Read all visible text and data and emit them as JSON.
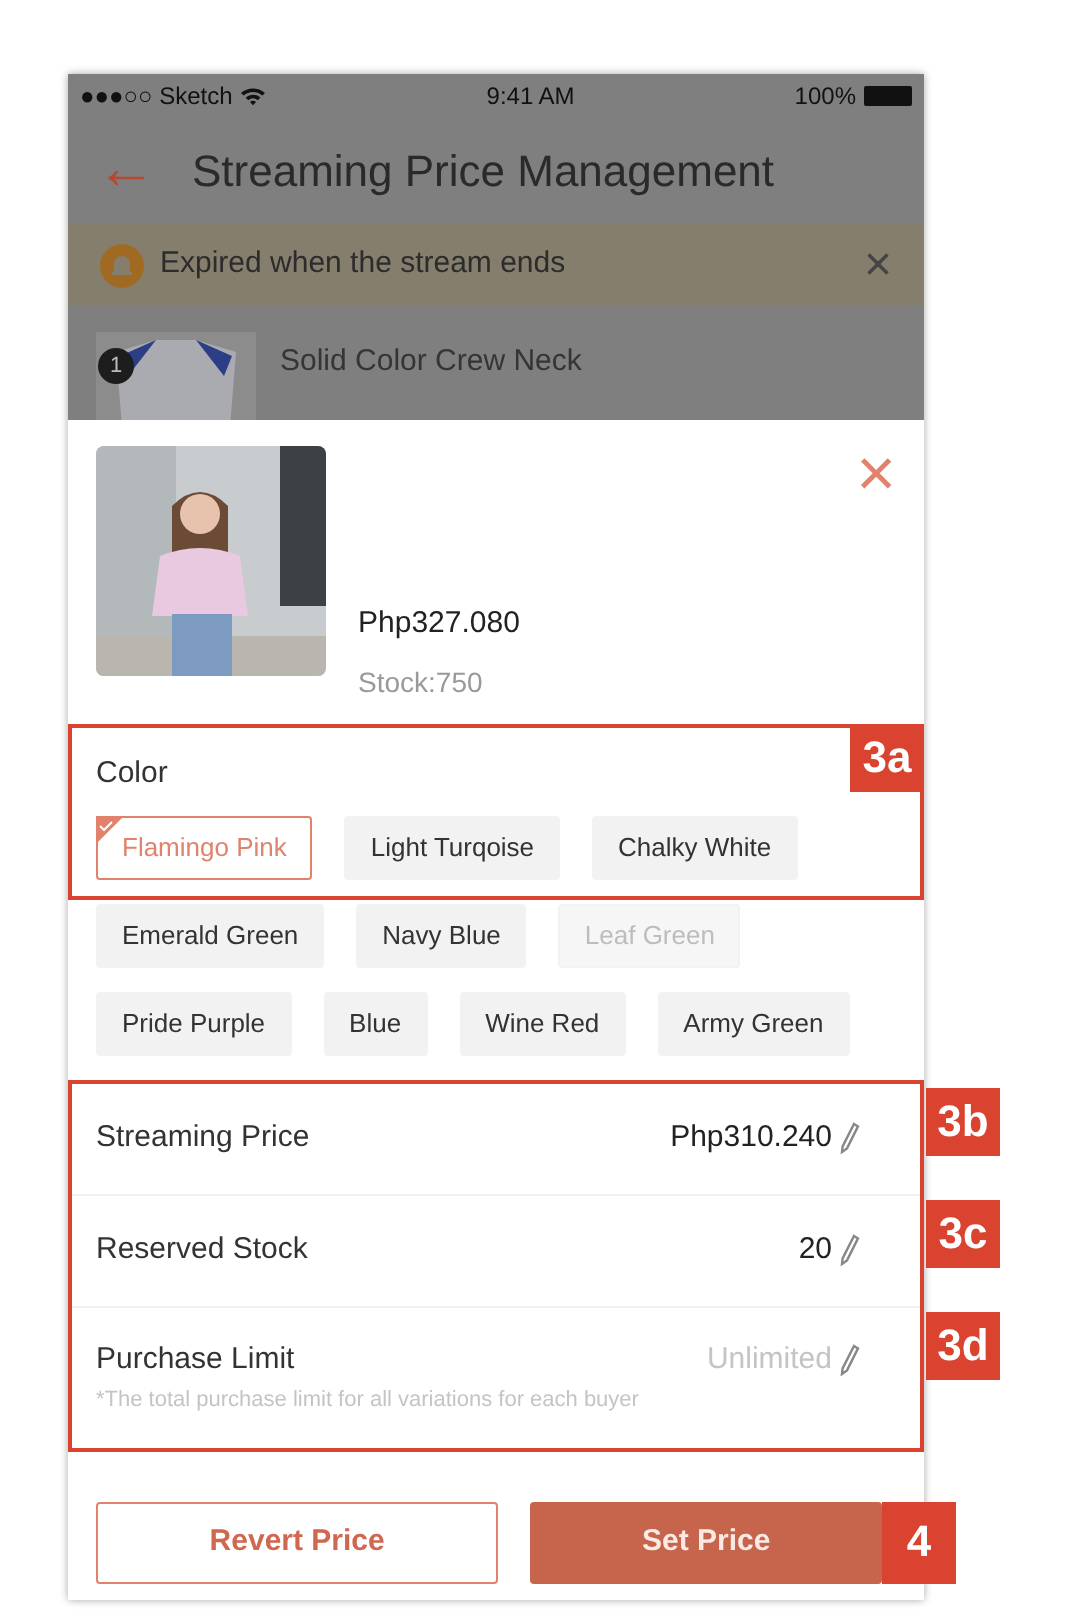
{
  "status_bar": {
    "carrier": "●●●○○ Sketch",
    "time": "9:41 AM",
    "battery": "100%"
  },
  "header": {
    "back": "←",
    "title": "Streaming Price Management"
  },
  "banner": {
    "text": "Expired when the stream ends",
    "close": "×"
  },
  "background_item": {
    "index": "1",
    "title": "Solid Color Crew Neck"
  },
  "sheet": {
    "close": "×",
    "price": "Php327.080",
    "stock": "Stock:750",
    "color": {
      "label": "Color",
      "annotation": "3a",
      "rows": [
        [
          {
            "label": "Flamingo Pink",
            "selected": true,
            "disabled": false
          },
          {
            "label": "Light Turqoise",
            "selected": false,
            "disabled": false
          },
          {
            "label": "Chalky White",
            "selected": false,
            "disabled": false
          }
        ],
        [
          {
            "label": "Emerald Green",
            "selected": false,
            "disabled": false
          },
          {
            "label": "Navy Blue",
            "selected": false,
            "disabled": false
          },
          {
            "label": "Leaf Green",
            "selected": false,
            "disabled": true
          }
        ],
        [
          {
            "label": "Pride Purple",
            "selected": false,
            "disabled": false
          },
          {
            "label": "Blue",
            "selected": false,
            "disabled": false
          },
          {
            "label": "Wine Red",
            "selected": false,
            "disabled": false
          },
          {
            "label": "Army Green",
            "selected": false,
            "disabled": false
          }
        ]
      ]
    },
    "fields": [
      {
        "label": "Streaming Price",
        "value": "Php310.240",
        "annotation": "3b"
      },
      {
        "label": "Reserved Stock",
        "value": "20",
        "annotation": "3c"
      },
      {
        "label": "Purchase Limit",
        "placeholder": "Unlimited",
        "note": "*The total purchase limit for all variations for each buyer",
        "annotation": "3d"
      }
    ],
    "buttons": [
      {
        "label": "Revert Price",
        "kind": "outline"
      },
      {
        "label": "Set Price",
        "kind": "primary",
        "annotation": "4"
      }
    ]
  }
}
